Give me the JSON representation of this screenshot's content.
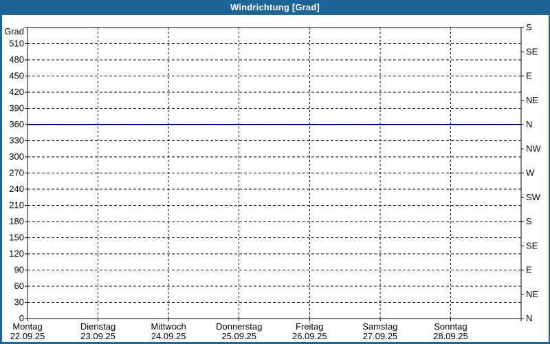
{
  "window": {
    "title": "Windrichtung [Grad]"
  },
  "colors": {
    "titlebar": "#1e6496",
    "window_border": "#1e6496",
    "background": "#ffffff",
    "grid": "#000000",
    "axis": "#000000",
    "text": "#000000",
    "series_line": "#0000cc"
  },
  "chart_data": {
    "type": "line",
    "title": "Windrichtung [Grad]",
    "y_axis_left": {
      "label": "Grad",
      "min": 0,
      "max": 540,
      "tick_step": 30,
      "tick_values": [
        0,
        30,
        60,
        90,
        120,
        150,
        180,
        210,
        240,
        270,
        300,
        330,
        360,
        390,
        420,
        450,
        480,
        510
      ]
    },
    "y_axis_right": {
      "tick_step": 45,
      "tick_values": [
        540,
        495,
        450,
        405,
        360,
        315,
        270,
        225,
        180,
        135,
        90,
        45,
        0
      ],
      "tick_labels": [
        "S",
        "SE",
        "E",
        "NE",
        "N",
        "NW",
        "W",
        "SW",
        "S",
        "SE",
        "E",
        "NE",
        "N"
      ]
    },
    "x_axis": {
      "days": [
        {
          "name": "Montag",
          "date": "22.09.25"
        },
        {
          "name": "Dienstag",
          "date": "23.09.25"
        },
        {
          "name": "Mittwoch",
          "date": "24.09.25"
        },
        {
          "name": "Donnerstag",
          "date": "25.09.25"
        },
        {
          "name": "Freitag",
          "date": "26.09.25"
        },
        {
          "name": "Samstag",
          "date": "27.09.25"
        },
        {
          "name": "Sonntag",
          "date": "28.09.25"
        }
      ]
    },
    "grid": {
      "horizontal_step": 30,
      "vertical": "day-boundaries",
      "style": "dashed"
    },
    "series": [
      {
        "name": "Windrichtung",
        "unit": "Grad",
        "color": "#0000cc",
        "values": [
          360,
          360,
          360,
          360,
          360,
          360,
          360,
          360
        ],
        "description": "constant 360 Grad (N) across entire week"
      }
    ],
    "legend": "none"
  }
}
